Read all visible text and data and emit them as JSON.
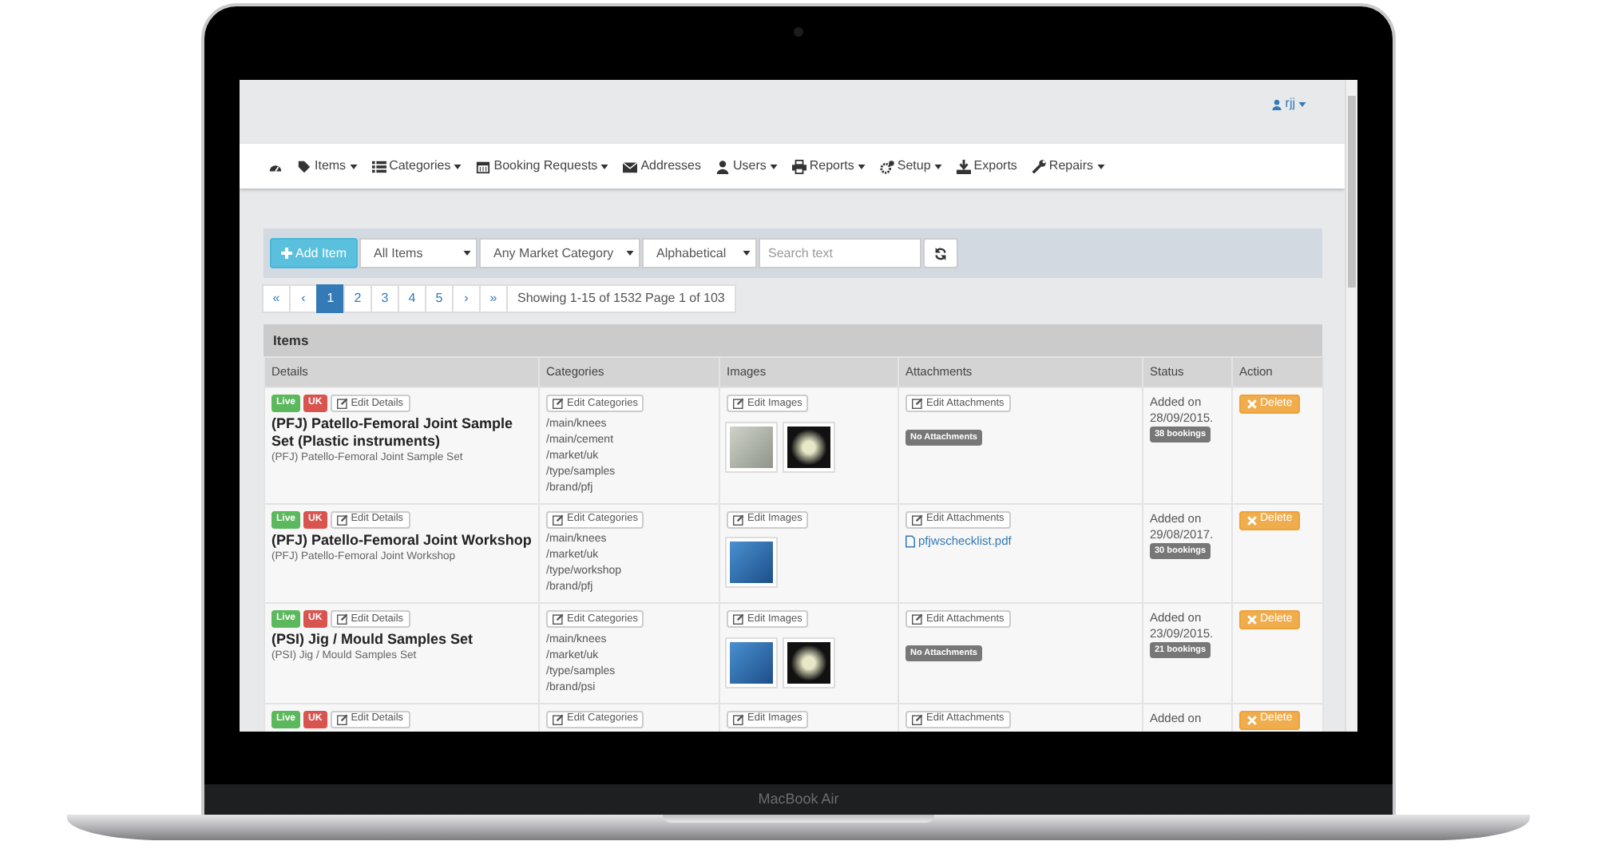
{
  "device": {
    "label": "MacBook Air"
  },
  "user_menu": {
    "label": "rjj"
  },
  "nav": [
    {
      "dropdown": false
    },
    {
      "label": "Items",
      "dropdown": true
    },
    {
      "label": "Categories",
      "dropdown": true
    },
    {
      "label": "Booking Requests",
      "dropdown": true
    },
    {
      "label": "Addresses",
      "dropdown": false
    },
    {
      "label": "Users",
      "dropdown": true
    },
    {
      "label": "Reports",
      "dropdown": true
    },
    {
      "label": "Setup",
      "dropdown": true
    },
    {
      "label": "Exports",
      "dropdown": false
    },
    {
      "label": "Repairs",
      "dropdown": true
    }
  ],
  "toolbar": {
    "add_button": "Add Item",
    "filters": [
      "All Items",
      "Any Market Category",
      "Alphabetical"
    ],
    "search": {
      "placeholder": "Search text"
    }
  },
  "pagination": {
    "pages": [
      {
        "label": "«",
        "selected": false
      },
      {
        "label": "‹",
        "selected": false
      },
      {
        "label": "1",
        "selected": true
      },
      {
        "label": "2",
        "selected": false
      },
      {
        "label": "3",
        "selected": false
      },
      {
        "label": "4",
        "selected": false
      },
      {
        "label": "5",
        "selected": false
      },
      {
        "label": "›",
        "selected": false
      },
      {
        "label": "»",
        "selected": false
      }
    ],
    "summary": "Showing 1-15 of 1532 Page 1 of 103"
  },
  "table": {
    "title": "Items",
    "columns": [
      "Details",
      "Categories",
      "Images",
      "Attachments",
      "Status",
      "Action"
    ],
    "rows": [
      {
        "badges": [
          {
            "text": "Live",
            "kind": "live"
          },
          {
            "text": "UK",
            "kind": "market"
          }
        ],
        "edit_details": "Edit Details",
        "title": "(PFJ) Patello-Femoral Joint Sample Set (Plastic instruments)",
        "subtitle": "(PFJ) Patello-Femoral Joint Sample Set",
        "edit_categories": "Edit Categories",
        "categories": [
          "/main/knees",
          "/main/cement",
          "/market/uk",
          "/type/samples",
          "/brand/pfj"
        ],
        "edit_images": "Edit Images",
        "images": [
          {
            "kind": "case"
          },
          {
            "kind": "implants"
          }
        ],
        "edit_attachments": "Edit Attachments",
        "attachments": [],
        "no_attachments": "No Attachments",
        "added": "Added on 28/09/2015.",
        "bookings": "38 bookings",
        "delete": "Delete"
      },
      {
        "badges": [
          {
            "text": "Live",
            "kind": "live"
          },
          {
            "text": "UK",
            "kind": "market"
          }
        ],
        "edit_details": "Edit Details",
        "title": "(PFJ) Patello-Femoral Joint Workshop",
        "subtitle": "(PFJ) Patello-Femoral Joint Workshop",
        "edit_categories": "Edit Categories",
        "categories": [
          "/main/knees",
          "/market/uk",
          "/type/workshop",
          "/brand/pfj"
        ],
        "edit_images": "Edit Images",
        "images": [
          {
            "kind": "tools"
          }
        ],
        "edit_attachments": "Edit Attachments",
        "attachments": [
          "pfjwschecklist.pdf"
        ],
        "added": "Added on 29/08/2017.",
        "bookings": "30 bookings",
        "delete": "Delete"
      },
      {
        "badges": [
          {
            "text": "Live",
            "kind": "live"
          },
          {
            "text": "UK",
            "kind": "market"
          }
        ],
        "edit_details": "Edit Details",
        "title": "(PSI) Jig / Mould Samples Set",
        "subtitle": "(PSI) Jig / Mould Samples Set",
        "edit_categories": "Edit Categories",
        "categories": [
          "/main/knees",
          "/market/uk",
          "/type/samples",
          "/brand/psi"
        ],
        "edit_images": "Edit Images",
        "images": [
          {
            "kind": "tools"
          },
          {
            "kind": "implants"
          }
        ],
        "edit_attachments": "Edit Attachments",
        "attachments": [],
        "no_attachments": "No Attachments",
        "added": "Added on 23/09/2015.",
        "bookings": "21 bookings",
        "delete": "Delete"
      },
      {
        "badges": [
          {
            "text": "Live",
            "kind": "live"
          },
          {
            "text": "UK",
            "kind": "market"
          }
        ],
        "edit_details": "Edit Details",
        "edit_categories": "Edit Categories",
        "edit_images": "Edit Images",
        "edit_attachments": "Edit Attachments",
        "added": "Added on",
        "delete": "Delete"
      }
    ]
  }
}
